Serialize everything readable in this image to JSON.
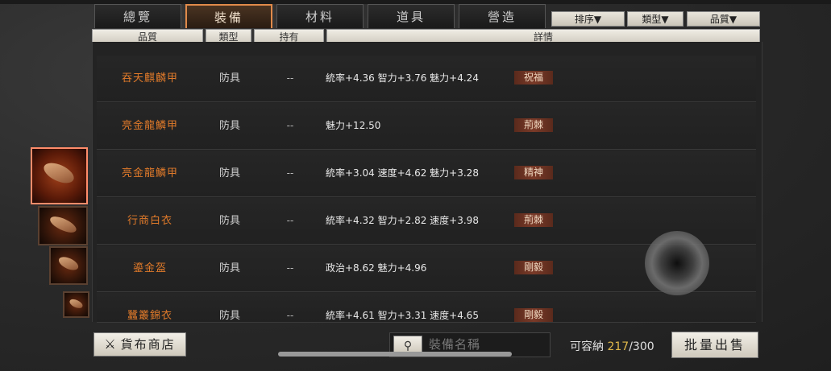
{
  "tabs": [
    "總覽",
    "裝備",
    "材料",
    "道具",
    "營造"
  ],
  "active_tab_index": 1,
  "dropdowns": [
    "排序▼",
    "類型▼",
    "品質▼"
  ],
  "columns": [
    "品質",
    "類型",
    "持有",
    "詳情"
  ],
  "rows": [
    {
      "name": "吞天麒麟甲",
      "type": "防具",
      "owned": "--",
      "stats": "統率+4.36 智力+3.76 魅力+4.24",
      "tag": "祝福"
    },
    {
      "name": "亮金龍鱗甲",
      "type": "防具",
      "owned": "--",
      "stats": "魅力+12.50",
      "tag": "荊棘"
    },
    {
      "name": "亮金龍鱗甲",
      "type": "防具",
      "owned": "--",
      "stats": "統率+3.04 速度+4.62 魅力+3.28",
      "tag": "精神"
    },
    {
      "name": "行商白衣",
      "type": "防具",
      "owned": "--",
      "stats": "統率+4.32 智力+2.82 速度+3.98",
      "tag": "荊棘"
    },
    {
      "name": "鎏金盔",
      "type": "防具",
      "owned": "--",
      "stats": "政治+8.62 魅力+4.96",
      "tag": "剛毅"
    },
    {
      "name": "蠶叢錦衣",
      "type": "防具",
      "owned": "--",
      "stats": "統率+4.61 智力+3.31 速度+4.65",
      "tag": "剛毅"
    }
  ],
  "footer": {
    "shop_button": "貨布商店",
    "search_placeholder": "裝備名稱",
    "capacity_label": "可容納",
    "capacity_current": "217",
    "capacity_sep": "/",
    "capacity_max": "300",
    "bulk_sell_button": "批量出售"
  },
  "colors": {
    "accent": "#e07a2a",
    "tab_active_border": "#e08a4a",
    "capacity_highlight": "#e0b84a"
  },
  "icons": {
    "shop": "sword-icon",
    "search": "magnifier-icon"
  }
}
